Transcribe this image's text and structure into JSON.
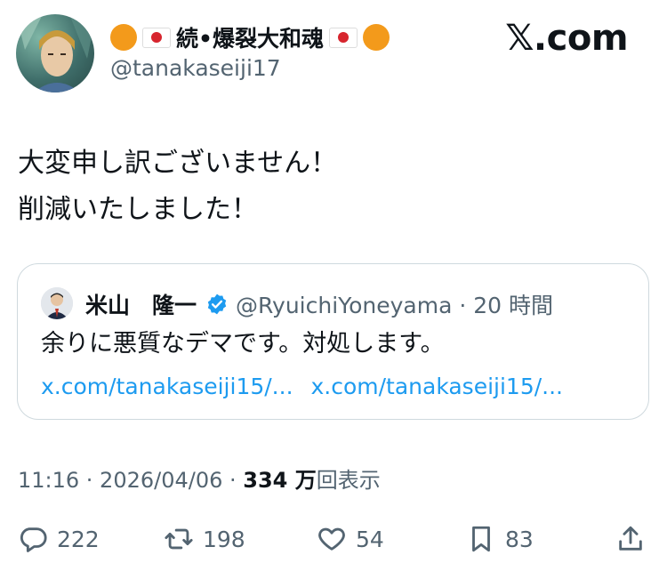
{
  "author": {
    "display_name": "続•爆裂大和魂",
    "handle": "@tanakaseiji17"
  },
  "brand": "𝕏.com",
  "tweet": {
    "lines": [
      "大変申し訳ございません！",
      "削減いたしました！"
    ]
  },
  "quoted": {
    "name": "米山　隆一",
    "meta": "@RyuichiYoneyama · 20 時間",
    "text": "余りに悪質なデマです。対処します。",
    "links": [
      "x.com/tanakaseiji15/...",
      "x.com/tanakaseiji15/..."
    ]
  },
  "meta": {
    "time": "11:16 · 2026/04/06 · ",
    "views": "334 万",
    "views_label": "回表示"
  },
  "actions": {
    "replies": "222",
    "reposts": "198",
    "likes": "54",
    "bookmarks": "83"
  },
  "colors": {
    "accent": "#1d9bf0",
    "text": "#0f1419",
    "muted": "#536471",
    "border": "#cfd9de"
  }
}
